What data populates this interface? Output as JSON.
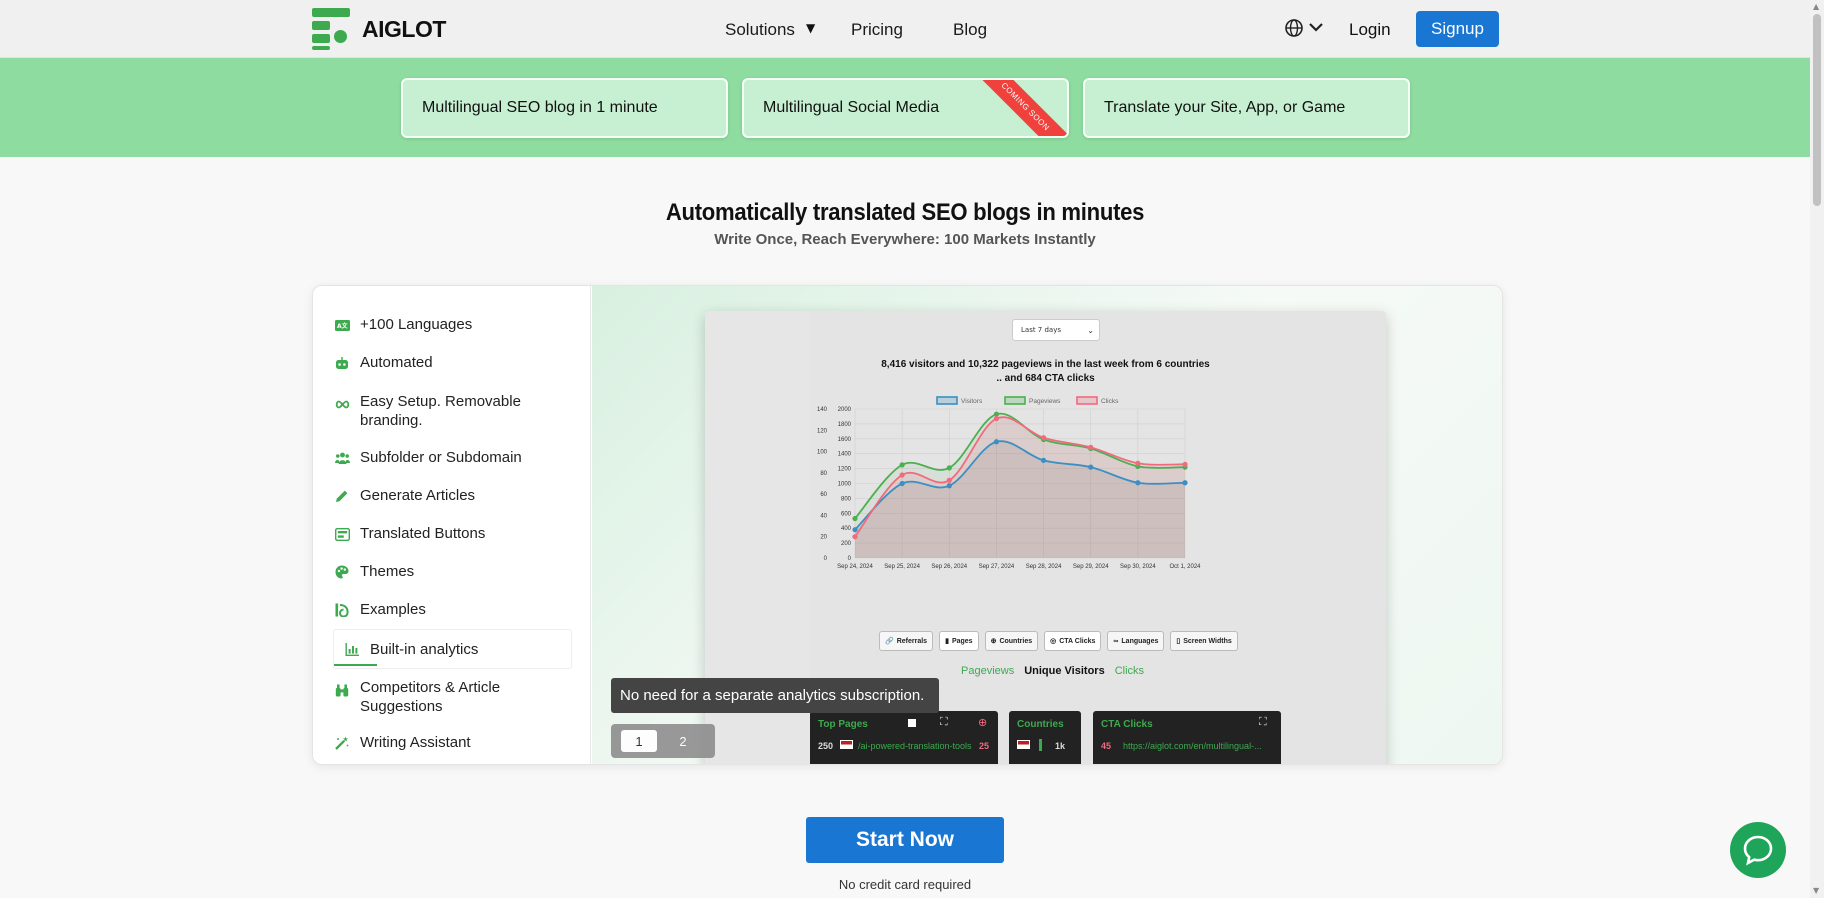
{
  "header": {
    "logo_text": "AIGLOT",
    "nav": {
      "solutions": "Solutions",
      "caret": "▼",
      "pricing": "Pricing",
      "blog": "Blog"
    },
    "login": "Login",
    "signup": "Signup"
  },
  "banner": {
    "cards": [
      {
        "label": "Multilingual SEO blog in 1 minute"
      },
      {
        "label": "Multilingual Social Media",
        "ribbon": "COMING SOON"
      },
      {
        "label": "Translate your Site, App, or Game"
      }
    ]
  },
  "hero": {
    "title": "Automatically translated SEO blogs in minutes",
    "subtitle": "Write Once, Reach Everywhere: 100 Markets Instantly"
  },
  "sidebar": {
    "items": [
      {
        "label": "+100 Languages",
        "icon": "translate-icon"
      },
      {
        "label": "Automated",
        "icon": "robot-icon"
      },
      {
        "label": "Easy Setup. Removable branding.",
        "icon": "infinity-icon"
      },
      {
        "label": "Subfolder or Subdomain",
        "icon": "users-icon"
      },
      {
        "label": "Generate Articles",
        "icon": "pencil-icon"
      },
      {
        "label": "Translated Buttons",
        "icon": "buttons-icon"
      },
      {
        "label": "Themes",
        "icon": "palette-icon"
      },
      {
        "label": "Examples",
        "icon": "examples-icon"
      },
      {
        "label": "Built-in analytics",
        "icon": "bar-chart-icon",
        "active": true
      },
      {
        "label": "Competitors & Article Suggestions",
        "icon": "binoculars-icon"
      },
      {
        "label": "Writing Assistant",
        "icon": "magic-wand-icon"
      }
    ]
  },
  "preview": {
    "range_select": "Last 7 days",
    "stat_line_1": "8,416 visitors and 10,322 pageviews in the last week from 6 countries",
    "stat_line_2": ".. and 684 CTA clicks",
    "tabs": [
      "Referrals",
      "Pages",
      "Countries",
      "CTA Clicks",
      "Languages",
      "Screen Widths"
    ],
    "modes": {
      "pageviews": "Pageviews",
      "unique": "Unique Visitors",
      "clicks": "Clicks"
    },
    "top_pages": {
      "title": "Top Pages",
      "row_count": "250",
      "row_path": "/ai-powered-translation-tools",
      "row_val": "25"
    },
    "countries": {
      "title": "Countries",
      "row_val": "1k"
    },
    "cta": {
      "title": "CTA Clicks",
      "row_val": "45",
      "row_url": "https://aiglot.com/en/multilingual-..."
    },
    "tooltip": "No need for a separate analytics subscription.",
    "pager": [
      "1",
      "2"
    ]
  },
  "cta": {
    "button": "Start Now",
    "note": "No credit card required"
  },
  "colors": {
    "accent": "#1976d2",
    "green": "#3daa4f",
    "banner": "#8edc9f",
    "visitors": "#3b8fc2",
    "pageviews": "#4caf50",
    "clicks": "#f06b7e"
  },
  "chart_data": {
    "type": "line",
    "legend": [
      "Visitors",
      "Pageviews",
      "Clicks"
    ],
    "categories": [
      "Sep 24, 2024",
      "Sep 25, 2024",
      "Sep 26, 2024",
      "Sep 27, 2024",
      "Sep 28, 2024",
      "Sep 29, 2024",
      "Sep 30, 2024",
      "Oct 1, 2024"
    ],
    "left_ticks": [
      "0",
      "20",
      "40",
      "60",
      "80",
      "100",
      "120",
      "140"
    ],
    "right_ticks": [
      "0",
      "200",
      "400",
      "600",
      "800",
      "1000",
      "1200",
      "1400",
      "1600",
      "1800",
      "2000"
    ],
    "ylim_left": [
      0,
      140
    ],
    "ylim_right": [
      0,
      2000
    ],
    "series": [
      {
        "name": "Visitors",
        "axis": "right",
        "values": [
          380,
          1000,
          970,
          1560,
          1310,
          1220,
          1010,
          1010
        ]
      },
      {
        "name": "Pageviews",
        "axis": "right",
        "values": [
          530,
          1250,
          1210,
          1930,
          1590,
          1470,
          1230,
          1220
        ]
      },
      {
        "name": "Clicks",
        "axis": "left",
        "values": [
          20,
          78,
          73,
          131,
          113,
          104,
          89,
          88
        ]
      }
    ]
  }
}
